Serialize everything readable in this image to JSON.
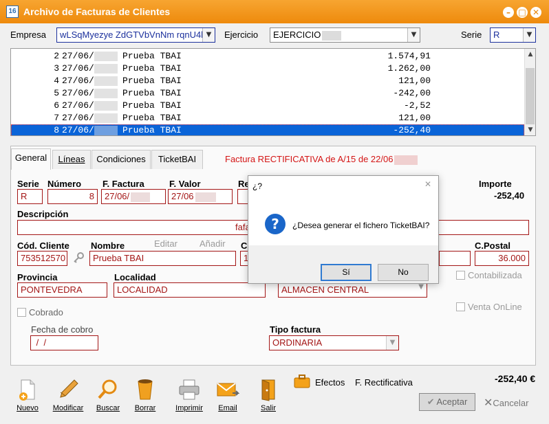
{
  "window": {
    "title": "Archivo de Facturas de Clientes",
    "app_icon_text": "16"
  },
  "header": {
    "empresa_label": "Empresa",
    "empresa_value": "wLSqMyezye ZdGTVbVnNm rqnU4l",
    "ejercicio_label": "Ejercicio",
    "ejercicio_value": "EJERCICIO",
    "serie_label": "Serie",
    "serie_value": "R"
  },
  "invoice_rows": [
    {
      "num": "2",
      "date": "27/06/",
      "name": "Prueba TBAI",
      "amount": "1.574,91",
      "selected": false
    },
    {
      "num": "3",
      "date": "27/06/",
      "name": "Prueba TBAI",
      "amount": "1.262,00",
      "selected": false
    },
    {
      "num": "4",
      "date": "27/06/",
      "name": "Prueba TBAI",
      "amount": "121,00",
      "selected": false
    },
    {
      "num": "5",
      "date": "27/06/",
      "name": "Prueba TBAI",
      "amount": "-242,00",
      "selected": false
    },
    {
      "num": "6",
      "date": "27/06/",
      "name": "Prueba TBAI",
      "amount": "-2,52",
      "selected": false
    },
    {
      "num": "7",
      "date": "27/06/",
      "name": "Prueba TBAI",
      "amount": "121,00",
      "selected": false
    },
    {
      "num": "8",
      "date": "27/06/",
      "name": "Prueba TBAI",
      "amount": "-252,40",
      "selected": true
    }
  ],
  "tabs": [
    {
      "label": "General",
      "active": true
    },
    {
      "label": "Líneas",
      "active": false
    },
    {
      "label": "Condiciones",
      "active": false
    },
    {
      "label": "TicketBAI",
      "active": false
    }
  ],
  "factura_title": "Factura RECTIFICATIVA de A/15 de 22/06",
  "form": {
    "serie_label": "Serie",
    "serie_value": "R",
    "numero_label": "Número",
    "numero_value": "8",
    "ffactura_label": "F. Factura",
    "ffactura_value": "27/06/",
    "fvalor_label": "F. Valor",
    "fvalor_value": "27/06",
    "re_label": "Re",
    "importe_label": "Importe",
    "importe_value": "-252,40",
    "descripcion_label": "Descripción",
    "descripcion_value": "fafa",
    "codcliente_label": "Cód. Cliente",
    "codcliente_value": "753512570",
    "nombre_label": "Nombre",
    "nombre_value": "Prueba TBAI",
    "editar_label": "Editar",
    "anadir_label": "Añadir",
    "cl_label": "Cl",
    "cl_value": "1",
    "cpostal_label": "C.Postal",
    "cpostal_value": "36.000",
    "provincia_label": "Provincia",
    "provincia_value": "PONTEVEDRA",
    "localidad_label": "Localidad",
    "localidad_value": "LOCALIDAD",
    "almacen_value": "ALMACEN CENTRAL",
    "contabilizada_label": "Contabilizada",
    "cobrado_label": "Cobrado",
    "ventaonline_label": "Venta OnLine",
    "fechacobro_label": "Fecha de cobro",
    "fechacobro_value": " /  /",
    "tipofactura_label": "Tipo factura",
    "tipofactura_value": "ORDINARIA"
  },
  "dialog": {
    "title": "¿?",
    "message": "¿Desea generar el fichero TicketBAI?",
    "yes_label": "Sí",
    "no_label": "No",
    "close": "✕"
  },
  "toolbar": {
    "nuevo": "Nuevo",
    "modificar": "Modificar",
    "buscar": "Buscar",
    "borrar": "Borrar",
    "imprimir": "Imprimir",
    "email": "Email",
    "salir": "Salir",
    "efectos": "Efectos",
    "rectificativa": "F. Rectificativa",
    "total": "-252,40 €",
    "aceptar": "Aceptar",
    "cancelar": "Cancelar"
  }
}
